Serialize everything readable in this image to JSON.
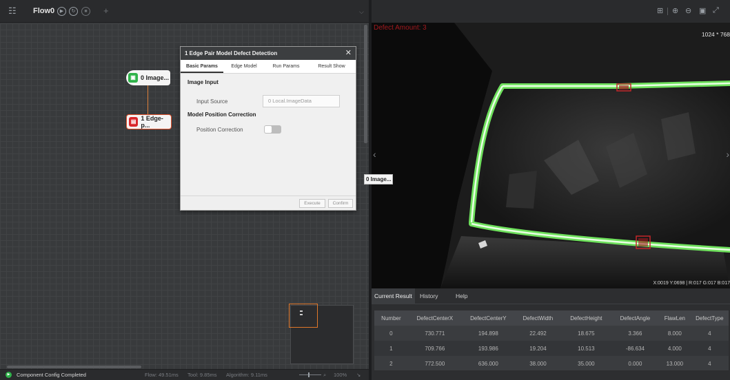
{
  "flow": {
    "tab_label": "Flow0",
    "nodes": [
      {
        "label": "0 Image...",
        "icon": "image-icon",
        "color": "#2fb24a"
      },
      {
        "label": "1 Edge-p...",
        "icon": "edge-pair-icon",
        "color": "#d9262b"
      }
    ],
    "floating_label": "0 Image..."
  },
  "dialog": {
    "title": "1 Edge Pair Model Defect Detection",
    "tabs": [
      "Basic Params",
      "Edge Model",
      "Run Params",
      "Result Show"
    ],
    "active_tab": "Basic Params",
    "sections": {
      "image_input": {
        "heading": "Image Input",
        "input_source_label": "Input Source",
        "input_source_value": "0 Local.ImageData"
      },
      "model_position": {
        "heading": "Model Position Correction",
        "position_correction_label": "Position Correction",
        "position_correction_on": false
      }
    },
    "buttons": {
      "execute": "Execute",
      "confirm": "Confirm"
    }
  },
  "status": {
    "message": "Component Config Completed",
    "flow_time": "Flow: 49.51ms",
    "tool_time": "Tool: 9.85ms",
    "algorithm_time": "Algorithm: 9.11ms",
    "zoom": "100%"
  },
  "viewer": {
    "defect_amount": "Defect Amount: 3",
    "resolution": "1024 * 768",
    "pixel_readout": "X:0019 Y:0698 | R:017 G:017 B:017"
  },
  "results": {
    "tabs": [
      "Current Result",
      "History",
      "Help"
    ],
    "active_tab": "Current Result",
    "columns": [
      "Number",
      "DefectCenterX",
      "DefectCenterY",
      "DefectWidth",
      "DefectHeight",
      "DefectAngle",
      "FlawLen",
      "DefectType"
    ],
    "rows": [
      [
        "0",
        "730.771",
        "194.898",
        "22.492",
        "18.675",
        "3.366",
        "8.000",
        "4"
      ],
      [
        "1",
        "709.766",
        "193.986",
        "19.204",
        "10.513",
        "-86.634",
        "4.000",
        "4"
      ],
      [
        "2",
        "772.500",
        "636.000",
        "38.000",
        "35.000",
        "0.000",
        "13.000",
        "4"
      ]
    ]
  },
  "colors": {
    "accent_orange": "#e2782a",
    "node_green": "#2fb24a",
    "node_red": "#d9262b",
    "defect_red": "#a3191e",
    "edge_green": "#7cf06b"
  }
}
